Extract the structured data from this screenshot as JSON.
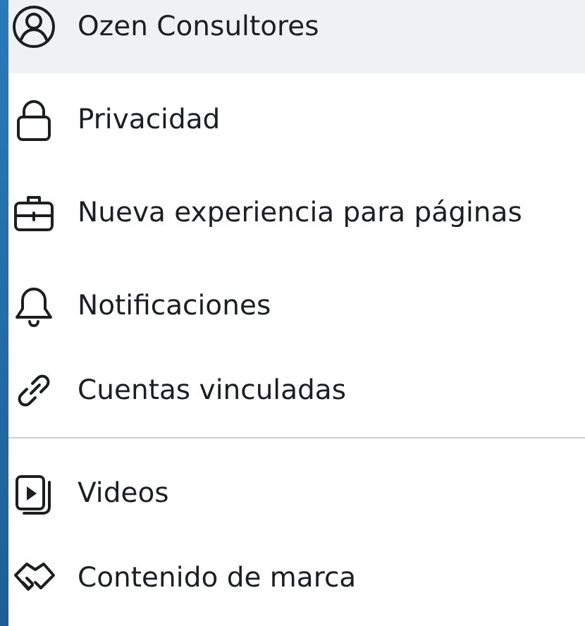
{
  "menu_groups": [
    {
      "items": [
        {
          "label": "Ozen Consultores",
          "selected": true
        },
        {
          "label": "Privacidad",
          "selected": false
        },
        {
          "label": "Nueva experiencia para páginas",
          "selected": false
        },
        {
          "label": "Notificaciones",
          "selected": false
        },
        {
          "label": "Cuentas vinculadas",
          "selected": false
        }
      ]
    },
    {
      "items": [
        {
          "label": "Videos",
          "selected": false
        },
        {
          "label": "Contenido de marca",
          "selected": false
        }
      ]
    }
  ]
}
